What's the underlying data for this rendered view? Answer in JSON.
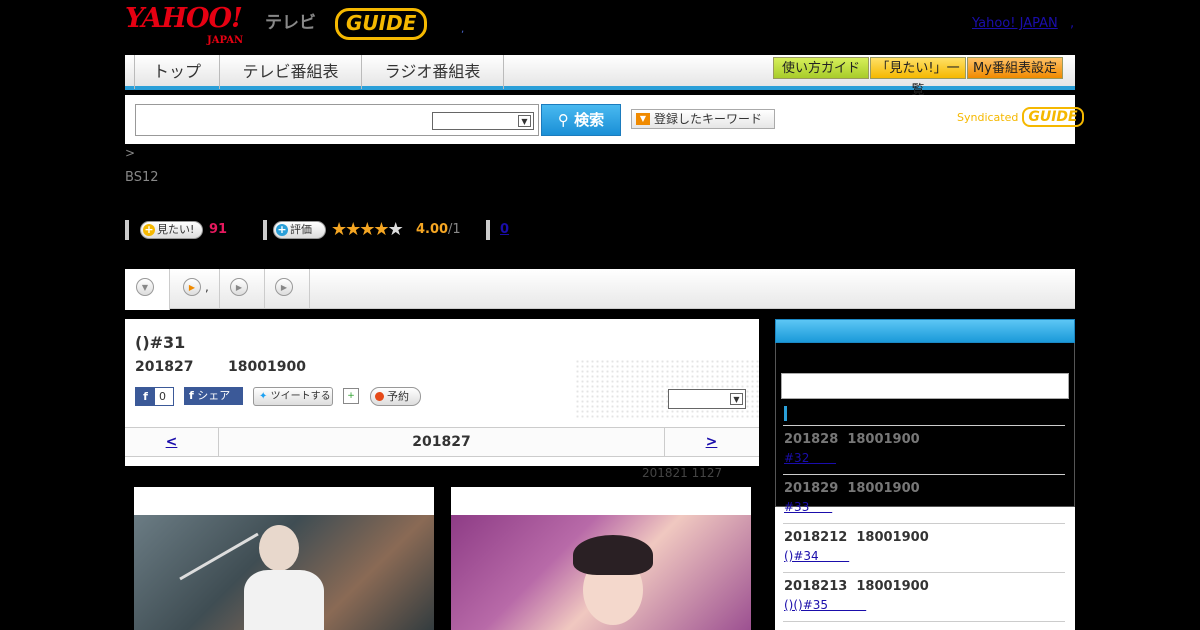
{
  "header": {
    "logo_yahoo": "YAHOO!",
    "logo_japan": "JAPAN",
    "logo_tv": "テレビ",
    "logo_gguide": "GUIDE",
    "dot": ",",
    "yahoo_japan_link": "Yahoo! JAPAN",
    "link_comma": ","
  },
  "nav": {
    "tabs": [
      "トップ",
      "テレビ番組表",
      "ラジオ番組表"
    ],
    "guide": "使い方ガイド",
    "mitai_list": "「見たい!」一覧",
    "my_schedule": "My番組表設定"
  },
  "search": {
    "button": "検索",
    "keyword_button": "登録したキーワード",
    "syndicated": "Syndicated",
    "syndicated_logo": "GUIDE"
  },
  "info": {
    "breadcrumb": ">",
    "channel": "BS12"
  },
  "stats": {
    "mitai_label": "見たい!",
    "mitai_count": "91",
    "rate_label": "評価",
    "rating": "4.00",
    "rating_max": "/1",
    "review_count": "0",
    "stars_filled": 4,
    "stars_total": 5
  },
  "tabs": {
    "items": [
      "",
      ",",
      "",
      ""
    ]
  },
  "program": {
    "title": "()#31",
    "date": "201827",
    "time": "18001900",
    "fb_like_count": "0",
    "fb_share": "シェア",
    "tweet": "ツイートする",
    "reserve": "予約",
    "pager_prev": "<",
    "pager_date": "201827",
    "pager_next": ">",
    "broadcast_note": "201821  1127"
  },
  "sidebar": {
    "episodes": [
      {
        "date": "201828  18001900",
        "link": "#32       "
      },
      {
        "date": "201829  18001900",
        "link": "#33      "
      },
      {
        "date": "2018212  18001900",
        "link": "()#34        "
      },
      {
        "date": "2018213  18001900",
        "link": "()()#35          "
      }
    ]
  },
  "colors": {
    "accent": "#2a9fd8",
    "yahoo_red": "#e60012",
    "gguide_yellow": "#f5b800",
    "mitai_pink": "#e6195e",
    "rating_orange": "#f5a623"
  }
}
